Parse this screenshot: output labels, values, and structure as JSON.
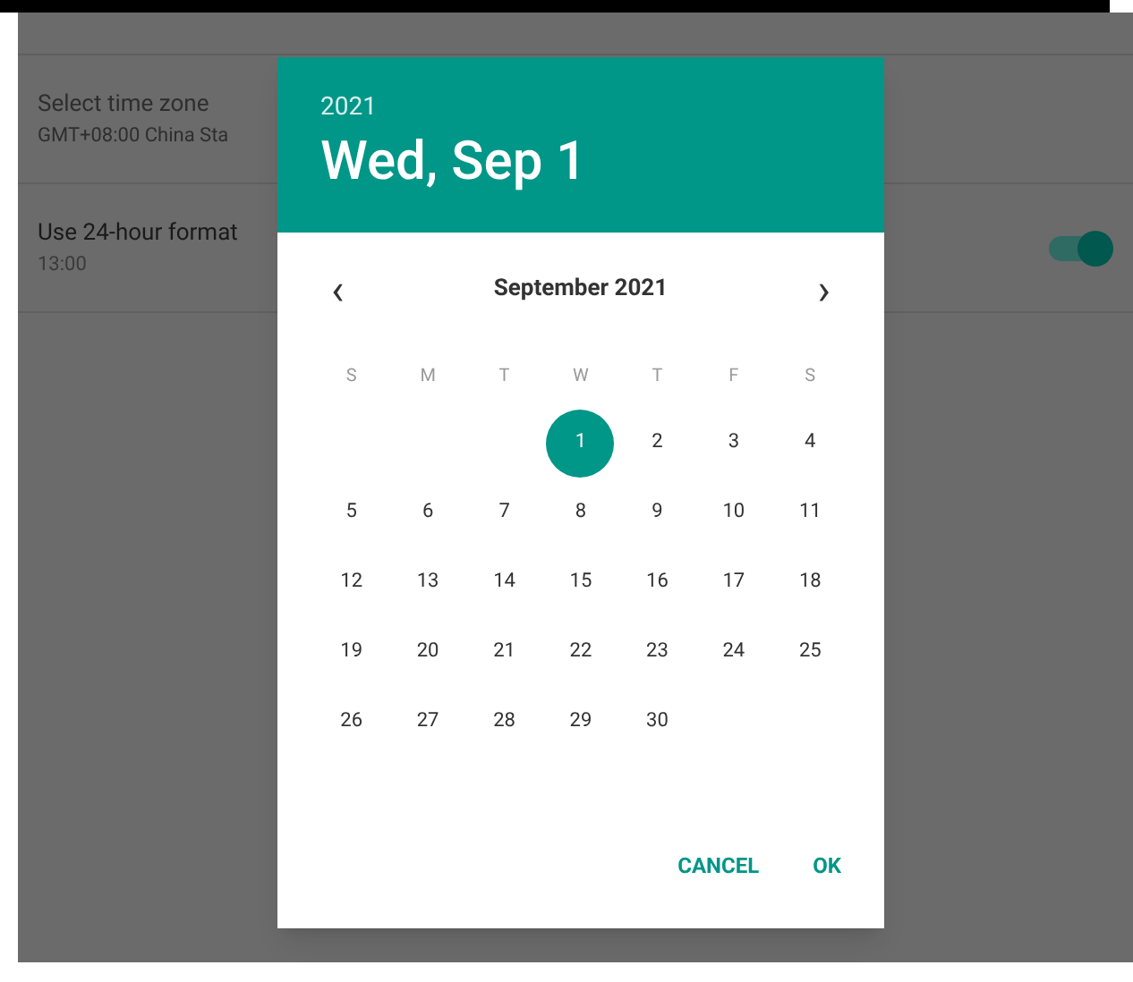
{
  "settings": [
    {
      "kind": "disabled",
      "title": "Select time zone",
      "subtitle": "GMT+08:00 China Sta"
    },
    {
      "kind": "switch",
      "title": "Use 24-hour format",
      "subtitle": "13:00",
      "on": true
    }
  ],
  "dialog": {
    "year": "2021",
    "date": "Wed, Sep 1",
    "month": "September 2021",
    "prev": "‹",
    "next": "›",
    "weekdays": [
      "S",
      "M",
      "T",
      "W",
      "T",
      "F",
      "S"
    ],
    "weeks": [
      [
        {
          "kind": "blank"
        },
        {
          "kind": "blank"
        },
        {
          "kind": "blank"
        },
        {
          "kind": "day",
          "day": "1",
          "selected": true
        },
        {
          "day": "2",
          "selected": false
        },
        {
          "day": "3",
          "selected": false
        },
        {
          "day": "4",
          "selected": false
        }
      ],
      [
        {
          "day": "5",
          "selected": false
        },
        {
          "day": "6",
          "selected": false
        },
        {
          "day": "7",
          "selected": false
        },
        {
          "day": "8",
          "selected": false
        },
        {
          "day": "9",
          "selected": false
        },
        {
          "day": "10",
          "selected": false
        },
        {
          "day": "11",
          "selected": false
        }
      ],
      [
        {
          "day": "12",
          "selected": false
        },
        {
          "day": "13",
          "selected": false
        },
        {
          "day": "14",
          "selected": false
        },
        {
          "day": "15",
          "selected": false
        },
        {
          "day": "16",
          "selected": false
        },
        {
          "day": "17",
          "selected": false
        },
        {
          "day": "18",
          "selected": false
        }
      ],
      [
        {
          "day": "19",
          "selected": false
        },
        {
          "day": "20",
          "selected": false
        },
        {
          "day": "21",
          "selected": false
        },
        {
          "day": "22",
          "selected": false
        },
        {
          "day": "23",
          "selected": false
        },
        {
          "day": "24",
          "selected": false
        },
        {
          "day": "25",
          "selected": false
        }
      ],
      [
        {
          "day": "26",
          "selected": false
        },
        {
          "day": "27",
          "selected": false
        },
        {
          "day": "28",
          "selected": false
        },
        {
          "day": "29",
          "selected": false
        },
        {
          "day": "30",
          "selected": false
        },
        {
          "kind": "blank"
        },
        {
          "kind": "blank"
        }
      ]
    ],
    "buttons": [
      "CANCEL",
      "OK"
    ]
  }
}
